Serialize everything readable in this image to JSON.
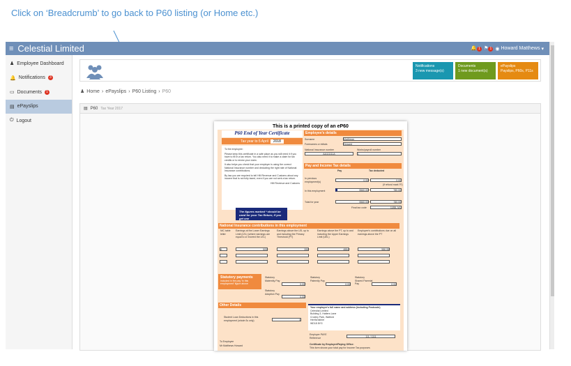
{
  "annotation": {
    "text": "Click on ‘Breadcrumb’ to go back to P60 listing (or Home etc.)"
  },
  "app": {
    "title": "Celestial Limited",
    "menu_icon": "hamburger-icon",
    "user_name": "Howard Matthews",
    "bell_count": "1",
    "flag_count": "1"
  },
  "sidebar": {
    "items": [
      {
        "label": "Employee Dashboard",
        "icon": "user-icon"
      },
      {
        "label": "Notifications",
        "badge": "3",
        "icon": "bell-icon"
      },
      {
        "label": "Documents",
        "badge": "1",
        "icon": "folder-icon"
      },
      {
        "label": "ePayslips",
        "icon": "doc-icon",
        "active": true
      },
      {
        "label": "Logout",
        "icon": "power-icon"
      }
    ]
  },
  "tiles": [
    {
      "title": "Notifications",
      "sub": "3 new message(s)",
      "color": "#1a97b0"
    },
    {
      "title": "Documents",
      "sub": "1 new document(s)",
      "color": "#6f9a1e"
    },
    {
      "title": "ePayslips",
      "sub": "Payslips, P60s, P11s",
      "color": "#e58a12"
    }
  ],
  "breadcrumb": [
    "Home",
    "ePayslips",
    "P60 Listing",
    "P60"
  ],
  "panel": {
    "title": "P60",
    "subtitle": "Tax Year 2017"
  },
  "doc": {
    "title": "This is a printed copy of an eP60",
    "cert_title": "P60 End of Year Certificate",
    "tax_year_label": "Tax year to 5 April",
    "tax_year": "2018",
    "to_employee": "To the employee:",
    "para1": "Please keep this certificate in a safe place as you will need it if you have to fill in a tax return. You also need it to make a claim for tax credits or to renew your claim.",
    "para2": "It also helps you check that your employer is using the correct National Insurance number and deducting the right rate of National Insurance contributions.",
    "para3": "By law you are required to tell HM Revenue and Customs about any income that is not fully taxed, even if you are not sent a tax return.",
    "hmrc": "HM Revenue and Customs",
    "figures_note": "The figures marked * should be used for your Tax Return, if you get one",
    "employee_details": "Employee's details",
    "surname_label": "Surname",
    "surname": "Matthews",
    "forenames_label": "Forenames or initials",
    "forenames": "Howard",
    "ni_label": "National Insurance number",
    "ni": "AA111111A",
    "works_label": "Works/payroll number",
    "works": "1",
    "pay_tax": "Pay and Income Tax details",
    "pay_h": "Pay",
    "tax_h": "Tax deducted",
    "prev_label": "In previous employment(s)",
    "prev_pay": "0.00",
    "prev_tax": "0.00",
    "refund": "(if refund mark 'R')",
    "this_label": "In this employment",
    "this_pay": "5560.00",
    "this_tax": "780.00",
    "total_label": "Total for year",
    "total_pay": "5560.00",
    "total_tax": "780.00",
    "final_code_label": "Final tax code",
    "final_code": "1185L M1",
    "ni_section": "National Insurance contributions in this employment",
    "ni_cols": [
      "NIC table letter",
      "Earnings at the Lower Earnings Limit (LEL) (where earnings are equal to or exceed the LEL)",
      "Earnings above the LEL up to and including the Primary Threshold (PT)",
      "Earnings above the PT, up to and including the Upper Earnings Limit (UEL)",
      "Employee's contributions due on all earnings above the PT"
    ],
    "ni_row": [
      "A",
      "509",
      "355",
      "4884",
      "586.08"
    ],
    "stat_title": "Statutory payments",
    "stat_sub": "included in the pay 'In this employment' figure above",
    "stat_items": [
      "Statutory Maternity Pay",
      "Statutory Paternity Pay",
      "Statutory Shared Parental Pay",
      "Statutory Adoption Pay"
    ],
    "stat_vals": [
      "0.00",
      "0.00",
      "0.00",
      "0.00"
    ],
    "other": "Other Details",
    "student_loan": "Student Loan Deductions in this employment (whole £s only)",
    "student_val": "0",
    "employer_title": "Your employer's full name and address (including Postcode)",
    "employer_lines": [
      "Celestial Limited",
      "Building 3, Hatters Lane",
      "Croxley Park, Watford",
      "Hertfordshire",
      "WD18 8YG"
    ],
    "paye_label": "Employer PAYE Reference",
    "paye": "111 / 1111",
    "to_employee2": "To Employee",
    "employee_name": "Mr Matthews Howard",
    "cert_by": "Certificate by Employer/Paying Office:",
    "cert_text": "This form shows your total pay for Income Tax purposes"
  }
}
